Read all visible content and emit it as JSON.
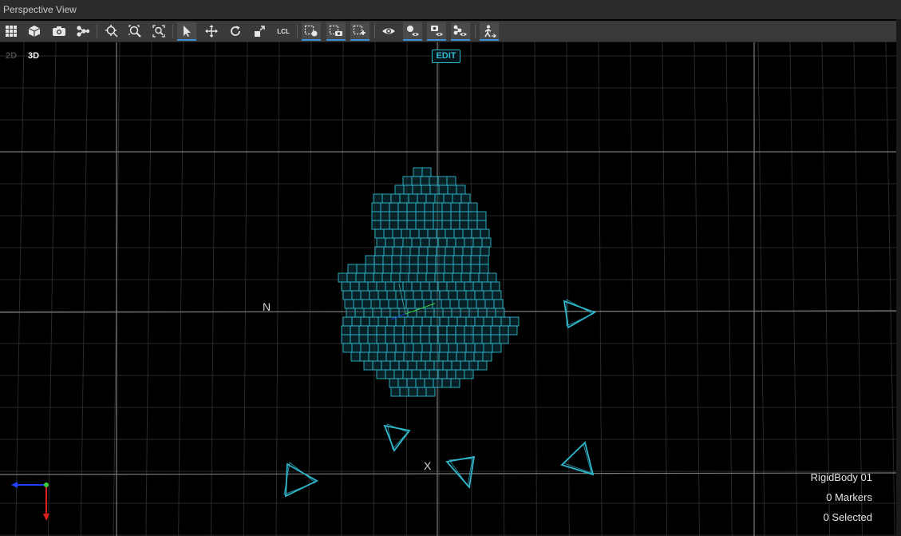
{
  "window": {
    "title": "Perspective View"
  },
  "toolbar": {
    "tools": [
      {
        "name": "layout-grid-icon"
      },
      {
        "name": "cube-icon"
      },
      {
        "name": "camera-icon"
      },
      {
        "name": "nodes-icon"
      },
      {
        "name": "zoom-fit-icon"
      },
      {
        "name": "zoom-selected-icon"
      },
      {
        "name": "zoom-all-icon"
      },
      {
        "name": "select-arrow-icon"
      },
      {
        "name": "move-icon"
      },
      {
        "name": "rotate-icon"
      },
      {
        "name": "scale-icon"
      },
      {
        "name": "local-coordinates-icon",
        "label": "LCL"
      },
      {
        "name": "select-markers-icon"
      },
      {
        "name": "select-cameras-icon"
      },
      {
        "name": "select-rigidbody-icon"
      },
      {
        "name": "eye-icon"
      },
      {
        "name": "view-markers-icon"
      },
      {
        "name": "view-cameras-icon"
      },
      {
        "name": "view-skeleton-icon"
      },
      {
        "name": "walk-person-icon"
      }
    ]
  },
  "view": {
    "mode_2d": "2D",
    "mode_3d": "3D",
    "active_mode": "3D",
    "edit_label": "EDIT",
    "axis_label_n": "N",
    "axis_label_x": "X"
  },
  "info": {
    "rigidbody_name": "RigidBody 01",
    "markers": "0 Markers",
    "selected": "0 Selected"
  },
  "colors": {
    "accent": "#2fb8cc",
    "toolbar_active_underline": "#3d8fd6",
    "grid_major": "#7a7a7a",
    "grid_minor": "#2a2a2a",
    "axis_x": "#e02020",
    "axis_y": "#39d039",
    "axis_z": "#2040ff"
  }
}
